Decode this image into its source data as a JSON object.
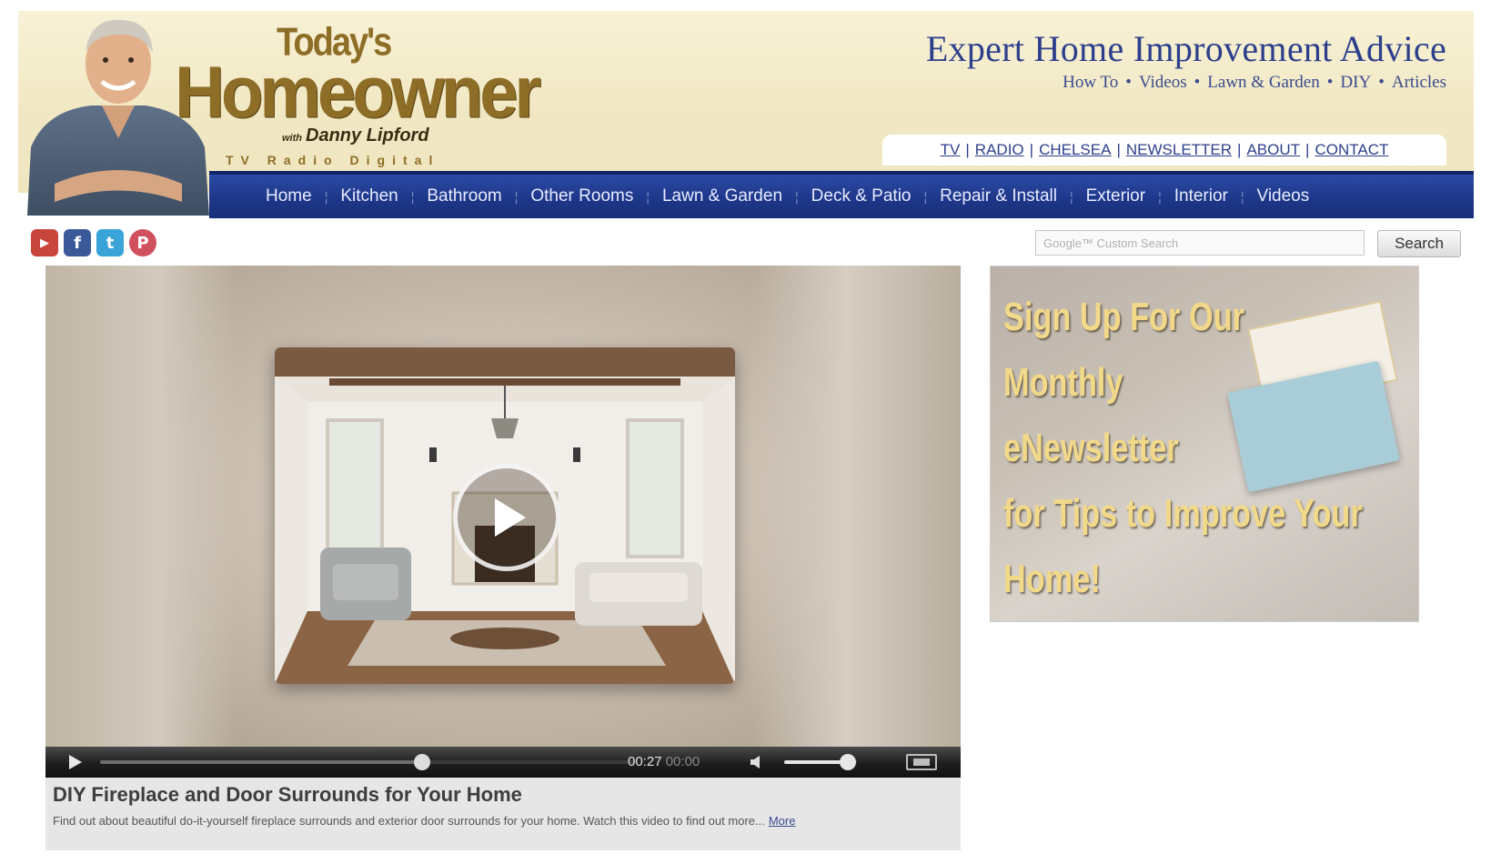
{
  "brand": {
    "logo_todays": "Today's",
    "logo_homeowner": "Homeowner",
    "logo_with_prefix": "with",
    "logo_host": "Danny Lipford",
    "logo_tagline": "TV Radio Digital"
  },
  "header": {
    "title": "Expert Home Improvement Advice",
    "subnav": [
      "How To",
      "Videos",
      "Lawn & Garden",
      "DIY",
      "Articles"
    ],
    "subnav_separator": "•",
    "util_links": [
      "TV",
      "RADIO",
      "CHELSEA",
      "NEWSLETTER",
      "ABOUT",
      "CONTACT"
    ],
    "util_separator": "|"
  },
  "mainnav": {
    "items": [
      "Home",
      "Kitchen",
      "Bathroom",
      "Other Rooms",
      "Lawn & Garden",
      "Deck & Patio",
      "Repair & Install",
      "Exterior",
      "Interior",
      "Videos"
    ]
  },
  "social": {
    "icons": [
      {
        "name": "youtube-icon",
        "glyph": "▶",
        "color": "#c8453c"
      },
      {
        "name": "facebook-icon",
        "glyph": "f",
        "color": "#3b5998"
      },
      {
        "name": "twitter-icon",
        "glyph": "t",
        "color": "#3aa3d8"
      },
      {
        "name": "pinterest-icon",
        "glyph": "P",
        "color": "#d05060"
      }
    ]
  },
  "search": {
    "placeholder": "Google™ Custom Search",
    "button_label": "Search"
  },
  "player": {
    "current_time": "00:27",
    "total_time": "00:00",
    "progress": 0.6,
    "volume": 0.88
  },
  "caption": {
    "title": "DIY Fireplace and Door Surrounds for Your Home",
    "description": "Find out about beautiful do-it-yourself fireplace surrounds and exterior door surrounds for your home. Watch this video to find out more...",
    "more_label": "More"
  },
  "ad": {
    "lines": [
      "Sign Up For Our",
      "Monthly",
      "eNewsletter",
      "for Tips to Improve Your",
      "Home!"
    ]
  },
  "colors": {
    "nav_blue": "#1d3687",
    "title_blue": "#2d3f8c",
    "logo_gold": "#8e6d27",
    "ad_text": "#f2d98a"
  }
}
